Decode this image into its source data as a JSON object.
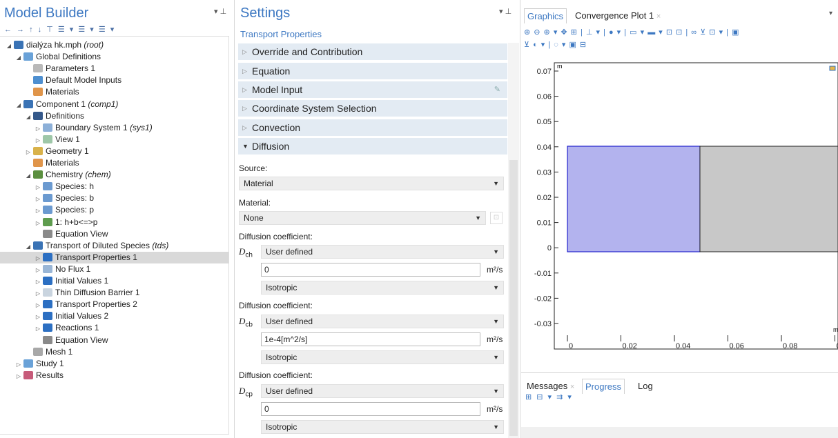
{
  "model_builder": {
    "title": "Model Builder",
    "pin": "▾ ⊥",
    "toolbar": "← → ↑ ↓ ⊤ ☰ ▾ ☰ ▾ ☰ ▾",
    "tree": [
      {
        "indent": 0,
        "arrow": "◢",
        "icon": "#3a73b5",
        "label": "dialýza hk.mph",
        "sub": "(root)"
      },
      {
        "indent": 1,
        "arrow": "◢",
        "icon": "#6aa2d8",
        "label": "Global Definitions",
        "sub": ""
      },
      {
        "indent": 2,
        "arrow": "",
        "icon": "#b9b9b9",
        "label": "Parameters 1",
        "sub": ""
      },
      {
        "indent": 2,
        "arrow": "",
        "icon": "#4e8fd0",
        "label": "Default Model Inputs",
        "sub": ""
      },
      {
        "indent": 2,
        "arrow": "",
        "icon": "#e0954a",
        "label": "Materials",
        "sub": ""
      },
      {
        "indent": 1,
        "arrow": "◢",
        "icon": "#3a73b5",
        "label": "Component 1",
        "sub": "(comp1)"
      },
      {
        "indent": 2,
        "arrow": "◢",
        "icon": "#34588a",
        "label": "Definitions",
        "sub": ""
      },
      {
        "indent": 3,
        "arrow": "▷",
        "icon": "#8db0d8",
        "label": "Boundary System 1",
        "sub": "(sys1)"
      },
      {
        "indent": 3,
        "arrow": "▷",
        "icon": "#9ec7a8",
        "label": "View 1",
        "sub": ""
      },
      {
        "indent": 2,
        "arrow": "▷",
        "icon": "#d9b24a",
        "label": "Geometry 1",
        "sub": ""
      },
      {
        "indent": 2,
        "arrow": "",
        "icon": "#e0954a",
        "label": "Materials",
        "sub": ""
      },
      {
        "indent": 2,
        "arrow": "◢",
        "icon": "#5b8f3f",
        "label": "Chemistry",
        "sub": "(chem)"
      },
      {
        "indent": 3,
        "arrow": "▷",
        "icon": "#6b9ad0",
        "label": "Species: h",
        "sub": ""
      },
      {
        "indent": 3,
        "arrow": "▷",
        "icon": "#6b9ad0",
        "label": "Species: b",
        "sub": ""
      },
      {
        "indent": 3,
        "arrow": "▷",
        "icon": "#6b9ad0",
        "label": "Species: p",
        "sub": ""
      },
      {
        "indent": 3,
        "arrow": "▷",
        "icon": "#5e9c4e",
        "label": "1: h+b<=>p",
        "sub": ""
      },
      {
        "indent": 3,
        "arrow": "",
        "icon": "#8a8a8a",
        "label": "Equation View",
        "sub": ""
      },
      {
        "indent": 2,
        "arrow": "◢",
        "icon": "#3a73b5",
        "label": "Transport of Diluted Species",
        "sub": "(tds)"
      },
      {
        "indent": 3,
        "arrow": "▷",
        "icon": "#2c6fc2",
        "label": "Transport Properties 1",
        "sub": "",
        "selected": true
      },
      {
        "indent": 3,
        "arrow": "▷",
        "icon": "#9ab6d6",
        "label": "No Flux 1",
        "sub": ""
      },
      {
        "indent": 3,
        "arrow": "▷",
        "icon": "#2c6fc2",
        "label": "Initial Values 1",
        "sub": ""
      },
      {
        "indent": 3,
        "arrow": "▷",
        "icon": "#c9d4df",
        "label": "Thin Diffusion Barrier 1",
        "sub": ""
      },
      {
        "indent": 3,
        "arrow": "▷",
        "icon": "#2c6fc2",
        "label": "Transport Properties 2",
        "sub": ""
      },
      {
        "indent": 3,
        "arrow": "▷",
        "icon": "#2c6fc2",
        "label": "Initial Values 2",
        "sub": ""
      },
      {
        "indent": 3,
        "arrow": "▷",
        "icon": "#2c6fc2",
        "label": "Reactions 1",
        "sub": ""
      },
      {
        "indent": 3,
        "arrow": "",
        "icon": "#8a8a8a",
        "label": "Equation View",
        "sub": ""
      },
      {
        "indent": 2,
        "arrow": "",
        "icon": "#a8a8a8",
        "label": "Mesh 1",
        "sub": ""
      },
      {
        "indent": 1,
        "arrow": "▷",
        "icon": "#6aa2d8",
        "label": "Study 1",
        "sub": ""
      },
      {
        "indent": 1,
        "arrow": "▷",
        "icon": "#c75b7a",
        "label": "Results",
        "sub": ""
      }
    ]
  },
  "settings": {
    "title": "Settings",
    "pin": "▾ ⊥",
    "subtitle": "Transport Properties",
    "sections": {
      "override": "Override and Contribution",
      "equation": "Equation",
      "model_input": "Model Input",
      "coord": "Coordinate System Selection",
      "convection": "Convection",
      "diffusion": "Diffusion"
    },
    "source_label": "Source:",
    "source_value": "Material",
    "material_label": "Material:",
    "material_value": "None",
    "diff_label": "Diffusion coefficient:",
    "rows": [
      {
        "var": "D",
        "sub": "ch",
        "type": "User defined",
        "value": "0",
        "unit": "m²/s",
        "aniso": "Isotropic"
      },
      {
        "var": "D",
        "sub": "cb",
        "type": "User defined",
        "value": "1e-4[m^2/s]",
        "unit": "m²/s",
        "aniso": "Isotropic"
      },
      {
        "var": "D",
        "sub": "cp",
        "type": "User defined",
        "value": "0",
        "unit": "m²/s",
        "aniso": "Isotropic"
      }
    ]
  },
  "graphics": {
    "tab_graphics": "Graphics",
    "tab_convergence": "Convergence Plot 1",
    "close": "×",
    "toolbar1": "⊕ ⊖ ⊕ ▾ ✥ ⊞ | ⊥ ▾ | ● ▾ | ▭ ▾ ▬ ▾ ⊡ ⊡ | ∞ ⊻ ⊡ ▾ | ▣",
    "toolbar2": "⊻ ◐ ▾ | ◌ ▾ ▣ ⊟",
    "unit_y": "m",
    "unit_x": "m",
    "y_ticks": [
      "0.07",
      "0.06",
      "0.05",
      "0.04",
      "0.03",
      "0.02",
      "0.01",
      "0",
      "-0.01",
      "-0.02",
      "-0.03"
    ],
    "x_ticks": [
      "0",
      "0.02",
      "0.04",
      "0.06",
      "0.08",
      "0"
    ],
    "colors": {
      "selected_domain": "#b3b3ee",
      "selected_edge": "#2222cc",
      "other_domain": "#c8c8c8"
    }
  },
  "messages": {
    "tab_messages": "Messages",
    "tab_progress": "Progress",
    "tab_log": "Log",
    "close": "×",
    "toolbar": "⊞ ⊟ ▾ ⇉ ▾"
  }
}
